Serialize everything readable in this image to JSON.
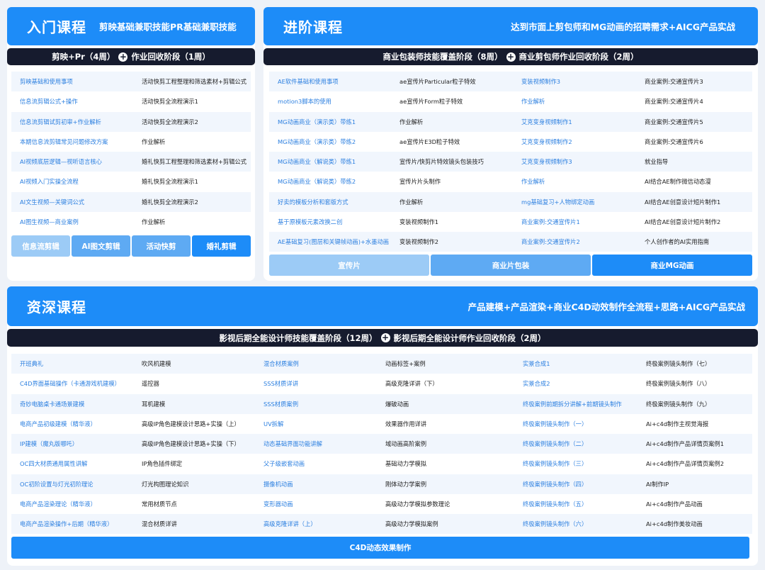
{
  "intro": {
    "title": "入门课程",
    "subtitle": "剪映基础兼职技能PR基础兼职技能",
    "stage_a": "剪映+Pr（4周）",
    "stage_b": "作业回收阶段（1周）",
    "rows": [
      [
        "剪映基础和使用事项",
        "活动快剪工程整理和筛选素材+剪辑公式"
      ],
      [
        "信息流剪辑公式+操作",
        "活动快剪全流程演示1"
      ],
      [
        "信息流剪辑试剪初审+作业解析",
        "活动快剪全流程演示2"
      ],
      [
        "本期信息流剪辑常见问题修改方案",
        "作业解析"
      ],
      [
        "AI视频底层逻辑—视听语言核心",
        "婚礼快剪工程整理和筛选素材+剪辑公式"
      ],
      [
        "AI视频入门实操全流程",
        "婚礼快剪全流程演示1"
      ],
      [
        "AI文生视频—关键词公式",
        "婚礼快剪全流程演示2"
      ],
      [
        "AI图生视频—商业案例",
        "作业解析"
      ]
    ],
    "buttons": [
      "信息流剪辑",
      "AI图文剪辑",
      "活动快剪",
      "婚礼剪辑"
    ]
  },
  "advanced": {
    "title": "进阶课程",
    "subtitle": "达到市面上剪包师和MG动画的招聘需求+AICG产品实战",
    "stage_a": "商业包装师技能覆盖阶段（8周）",
    "stage_b": "商业剪包师作业回收阶段（2周）",
    "rows": [
      [
        "AE软件基础和使用事项",
        "ae宣传片Particular粒子特效",
        "变装视频制作3",
        "商业案例:交通宣传片3"
      ],
      [
        "motion3脚本的使用",
        "ae宣传片Form粒子特效",
        "作业解析",
        "商业案例:交通宣传片4"
      ],
      [
        "MG动画商业（演示类）带练1",
        "作业解析",
        "艾克变身视频制作1",
        "商业案例:交通宣传片5"
      ],
      [
        "MG动画商业（演示类）带练2",
        "ae宣传片E3D粒子特效",
        "艾克变身视频制作2",
        "商业案例:交通宣传片6"
      ],
      [
        "MG动画商业（解说类）带练1",
        "宣传片/快剪片特效镜头包装技巧",
        "艾克变身视频制作3",
        "就业指导"
      ],
      [
        "MG动画商业（解说类）带练2",
        "宣传片片头制作",
        "作业解析",
        "AI结合AE制作微信动态漫"
      ],
      [
        "好卖的模板分析和套版方式",
        "作业解析",
        "mg基础复习+人物绑定动画",
        "AI结合AE创意设计短片制作1"
      ],
      [
        "基于原模板元素改换二创",
        "变装视频制作1",
        "商业案例:交通宣传片1",
        "AI结合AE创意设计短片制作2"
      ],
      [
        "AE基础复习(图层和关键帧动画)+水墨动画",
        "变装视频制作2",
        "商业案例:交通宣传片2",
        "个人创作者的AI实用指南"
      ]
    ],
    "buttons": [
      "宣传片",
      "商业片包装",
      "商业MG动画"
    ]
  },
  "senior": {
    "title": "资深课程",
    "subtitle": "产品建模+产品渲染+商业C4D动效制作全流程+思路+AICG产品实战",
    "stage_a": "影视后期全能设计师技能覆盖阶段（12周）",
    "stage_b": "影视后期全能设计师作业回收阶段（2周）",
    "rows": [
      [
        "开班典礼",
        "吹风机建模",
        "混合材质案例",
        "动画标签+案例",
        "实景合成1",
        "终极案例镜头制作（七）"
      ],
      [
        "C4D界面基础操作（卡通游戏机建模）",
        "遥控器",
        "SSS材质详讲",
        "高级克隆详讲（下）",
        "实景合成2",
        "终极案例镜头制作（八）"
      ],
      [
        "奇妙电脑桌卡通场景建模",
        "耳机建模",
        "SSS材质案例",
        "爆破动画",
        "终极案例前期拆分讲解+前期镜头制作",
        "终极案例镜头制作（九）"
      ],
      [
        "电商产品初级建模（精华液）",
        "高级IP角色建模设计思路+实操（上）",
        "UV拆解",
        "效果器作用详讲",
        "终极案例镜头制作（一）",
        "Ai+c4d制作主视觉海报"
      ],
      [
        "IP建模（魔丸版哪吒）",
        "高级IP角色建模设计思路+实操（下）",
        "动态基础界面功能讲解",
        "域动画高阶案例",
        "终极案例镜头制作（二）",
        "Ai+c4d制作产品详情页案例1"
      ],
      [
        "OC四大材质通用属性讲解",
        "IP角色插件绑定",
        "父子级嵌套动画",
        "基础动力学模拟",
        "终极案例镜头制作（三）",
        "Ai+c4d制作产品详情页案例2"
      ],
      [
        "OC初阶设置与灯光初阶理论",
        "灯光构图理论知识",
        "摄像机动画",
        "刚体动力学案例",
        "终极案例镜头制作（四）",
        "AI制作IP"
      ],
      [
        "电商产品渲染理论（精华液）",
        "常用材质节点",
        "变形器动画",
        "高级动力学模拟参数理论",
        "终极案例镜头制作（五）",
        "Ai+c4d制作产品动画"
      ],
      [
        "电商产品渲染操作+后期（精华液）",
        "混合材质详讲",
        "高级克隆详讲（上）",
        "高级动力学模拟案例",
        "终极案例镜头制作（六）",
        "Ai+c4d制作美妆动画"
      ]
    ],
    "buttons": [
      "C4D动态效果制作"
    ]
  },
  "colors": {
    "header_blue": "#1d8cf8",
    "dark_bar": "#161b2e",
    "link_blue": "#2b7fe0",
    "btn_light": "#9ccbf6",
    "btn_mid": "#5eaaf3",
    "btn_dark": "#1d8cf8"
  },
  "icons": {
    "plus": "+"
  }
}
